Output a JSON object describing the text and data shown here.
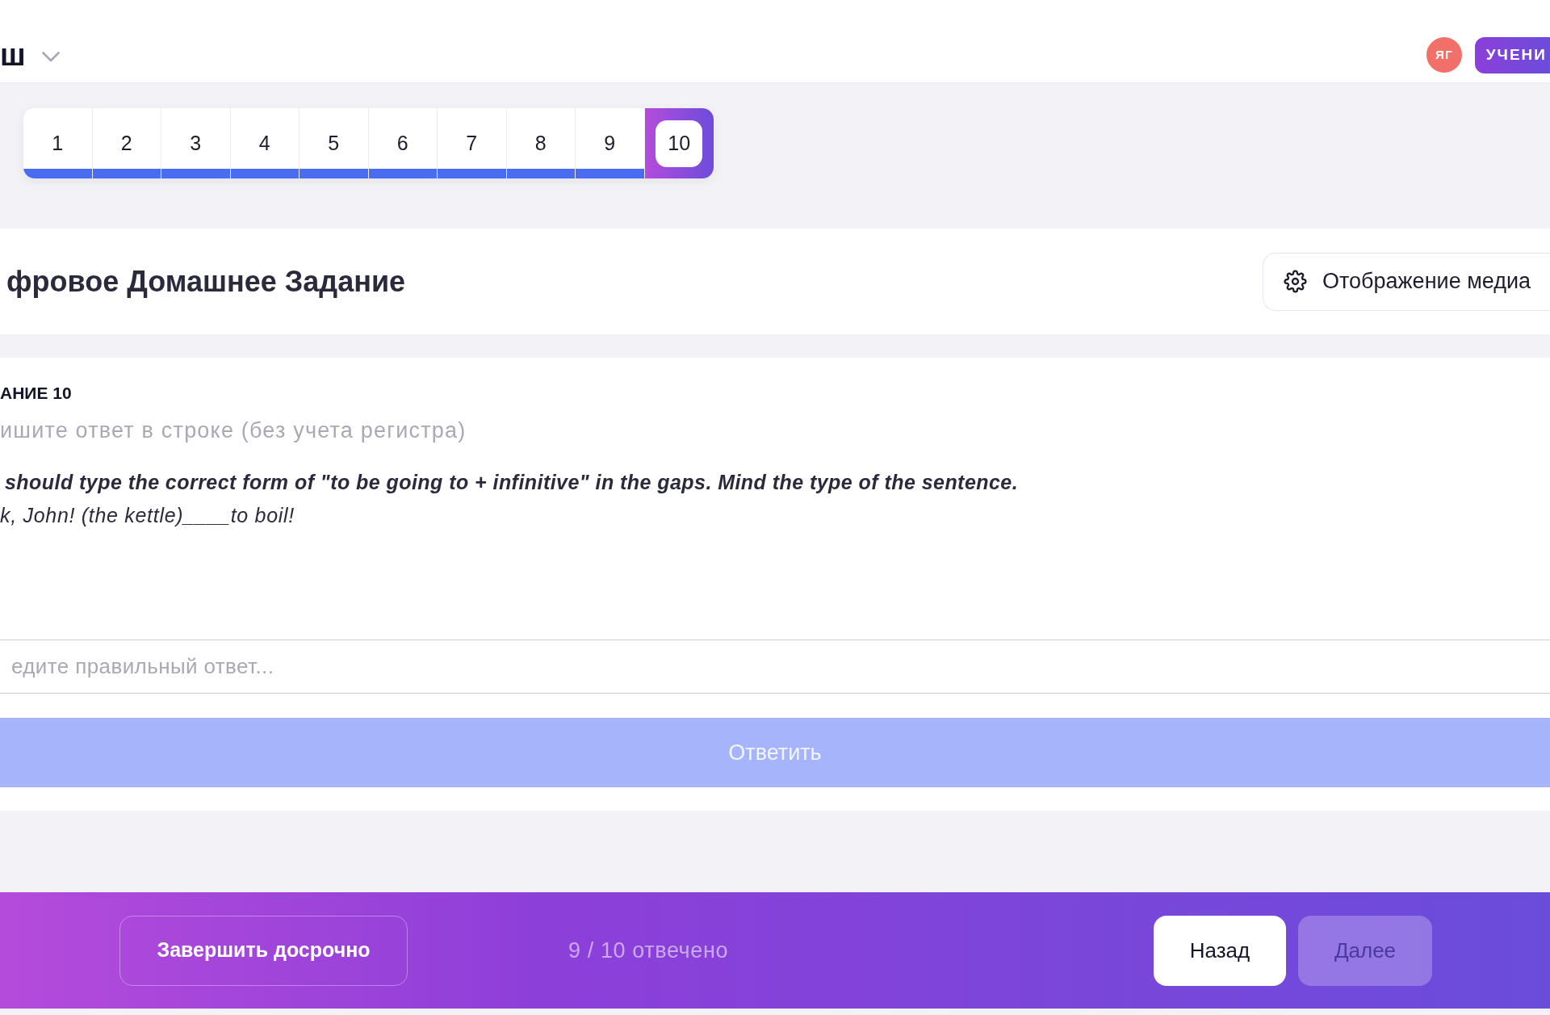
{
  "header": {
    "logo_text": "ш",
    "avatar_initials": "ЯГ",
    "role_badge": "УЧЕНИ"
  },
  "question_nav": {
    "items": [
      {
        "label": "1",
        "answered": true,
        "selected": false
      },
      {
        "label": "2",
        "answered": true,
        "selected": false
      },
      {
        "label": "3",
        "answered": true,
        "selected": false
      },
      {
        "label": "4",
        "answered": true,
        "selected": false
      },
      {
        "label": "5",
        "answered": true,
        "selected": false
      },
      {
        "label": "6",
        "answered": true,
        "selected": false
      },
      {
        "label": "7",
        "answered": true,
        "selected": false
      },
      {
        "label": "8",
        "answered": true,
        "selected": false
      },
      {
        "label": "9",
        "answered": true,
        "selected": false
      },
      {
        "label": "10",
        "answered": false,
        "selected": true
      }
    ]
  },
  "title_bar": {
    "title": "фровое Домашнее Задание",
    "media_button": "Отображение медиа"
  },
  "task": {
    "heading": "АНИЕ 10",
    "instruction": "ишите ответ в строке (без учета регистра)",
    "prompt": "should type the correct form of \"to be going to + infinitive\" in the gaps. Mind the type of the sentence.",
    "sentence": "k, John! (the kettle)____to boil!",
    "answer": {
      "placeholder": "едите правильный ответ..."
    },
    "submit": {
      "label": "Ответить",
      "disabled": true
    }
  },
  "footer": {
    "finish_button": "Завершить досрочно",
    "progress_text": "9 / 10 отвечено",
    "back_button": {
      "label": "Назад",
      "disabled": false
    },
    "next_button": {
      "label": "Далее",
      "disabled": true
    }
  }
}
